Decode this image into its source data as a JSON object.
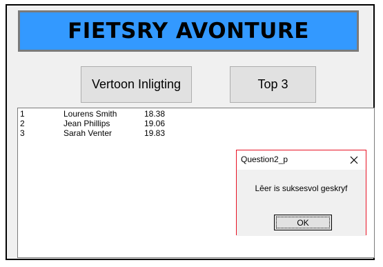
{
  "app": {
    "title": "FIETSRY AVONTURE",
    "buttons": {
      "info_label": "Vertoon Inligting",
      "top3_label": "Top 3"
    }
  },
  "results": {
    "rows": [
      {
        "rank": "1",
        "name": "Lourens Smith",
        "time": "18.38"
      },
      {
        "rank": "2",
        "name": "Jean Phillips",
        "time": "19.06"
      },
      {
        "rank": "3",
        "name": "Sarah Venter",
        "time": "19.83"
      }
    ]
  },
  "dialog": {
    "title": "Question2_p",
    "message": "Lêer is suksesvol geskryf",
    "ok_label": "OK",
    "close_icon": "close-icon"
  },
  "colors": {
    "banner": "#3399ff",
    "dialog_border": "#e81123"
  }
}
